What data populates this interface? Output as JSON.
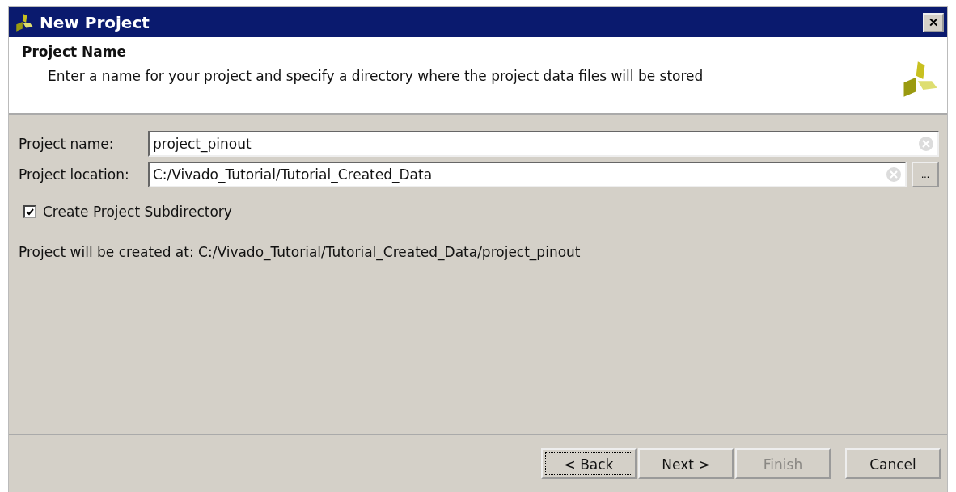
{
  "window": {
    "title": "New Project",
    "close": "✕"
  },
  "header": {
    "title": "Project Name",
    "description": "Enter a name for your project and specify a directory where the project data files will be stored"
  },
  "fields": [
    {
      "label": "Project name:",
      "value": "project_pinout"
    },
    {
      "label": "Project location:",
      "value": "C:/Vivado_Tutorial/Tutorial_Created_Data",
      "browse": "..."
    }
  ],
  "checkbox": {
    "label": "Create Project Subdirectory",
    "checked": true
  },
  "info": "Project will be created at: C:/Vivado_Tutorial/Tutorial_Created_Data/project_pinout",
  "buttons": [
    {
      "label": "< Back",
      "focused": true,
      "disabled": false
    },
    {
      "label": "Next >",
      "focused": false,
      "disabled": false
    },
    {
      "label": "Finish",
      "focused": false,
      "disabled": true
    },
    {
      "label": "Cancel",
      "focused": false,
      "disabled": false
    }
  ]
}
